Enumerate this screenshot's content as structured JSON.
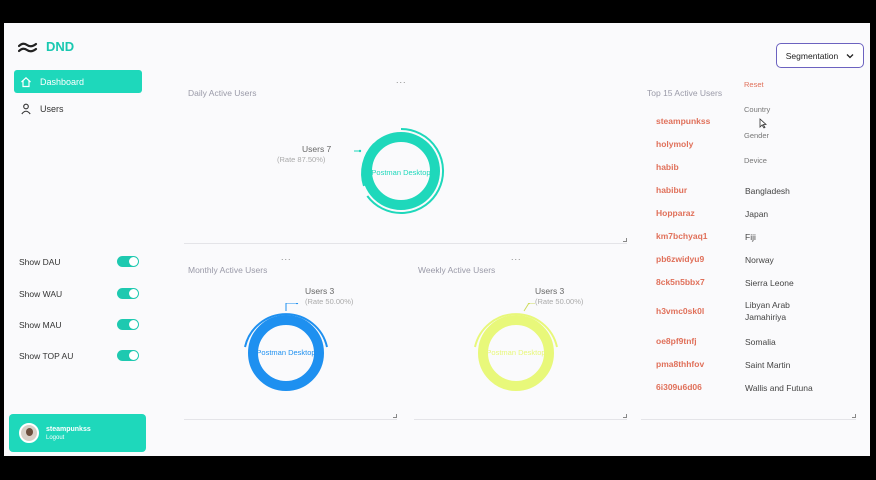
{
  "app": {
    "name": "DND"
  },
  "nav": [
    {
      "label": "Dashboard",
      "icon": "home-icon",
      "active": true
    },
    {
      "label": "Users",
      "icon": "user-icon",
      "active": false
    }
  ],
  "toggles": [
    {
      "label": "Show DAU",
      "on": true
    },
    {
      "label": "Show WAU",
      "on": true
    },
    {
      "label": "Show MAU",
      "on": true
    },
    {
      "label": "Show TOP AU",
      "on": true
    }
  ],
  "user": {
    "name": "steampunkss",
    "logout": "Logout"
  },
  "segmentation": {
    "label": "Segmentation",
    "options": [
      "Reset",
      "Country",
      "Gender",
      "Device"
    ]
  },
  "dau": {
    "title": "Daily Active Users",
    "menu": "...",
    "users": "Users 7",
    "rate": "(Rate 87.50%)",
    "center": "Postman Desktop",
    "color": "#1ed8bb"
  },
  "mau": {
    "title": "Monthly Active Users",
    "menu": "...",
    "users": "Users 3",
    "rate": "(Rate 50.00%)",
    "center": "Postman Desktop",
    "color": "#1e90f0"
  },
  "wau": {
    "title": "Weekly Active Users",
    "menu": "...",
    "users": "Users 3",
    "rate": "(Rate 50.00%)",
    "center": "Postman Desktop",
    "color": "#e8f87a"
  },
  "top": {
    "title": "Top 15 Active Users",
    "rows": [
      {
        "name": "steampunkss",
        "country": ""
      },
      {
        "name": "holymoly",
        "country": ""
      },
      {
        "name": "habib",
        "country": ""
      },
      {
        "name": "habibur",
        "country": "Bangladesh"
      },
      {
        "name": "Hopparaz",
        "country": "Japan"
      },
      {
        "name": "km7bchyaq1",
        "country": "Fiji"
      },
      {
        "name": "pb6zwidyu9",
        "country": "Norway"
      },
      {
        "name": "8ck5n5bbx7",
        "country": "Sierra Leone"
      },
      {
        "name": "h3vmc0sk0l",
        "country": "Libyan Arab Jamahiriya"
      },
      {
        "name": "oe8pf9tnfj",
        "country": "Somalia"
      },
      {
        "name": "pma8thhfov",
        "country": "Saint Martin"
      },
      {
        "name": "6i309u6d06",
        "country": "Wallis and Futuna"
      }
    ]
  }
}
